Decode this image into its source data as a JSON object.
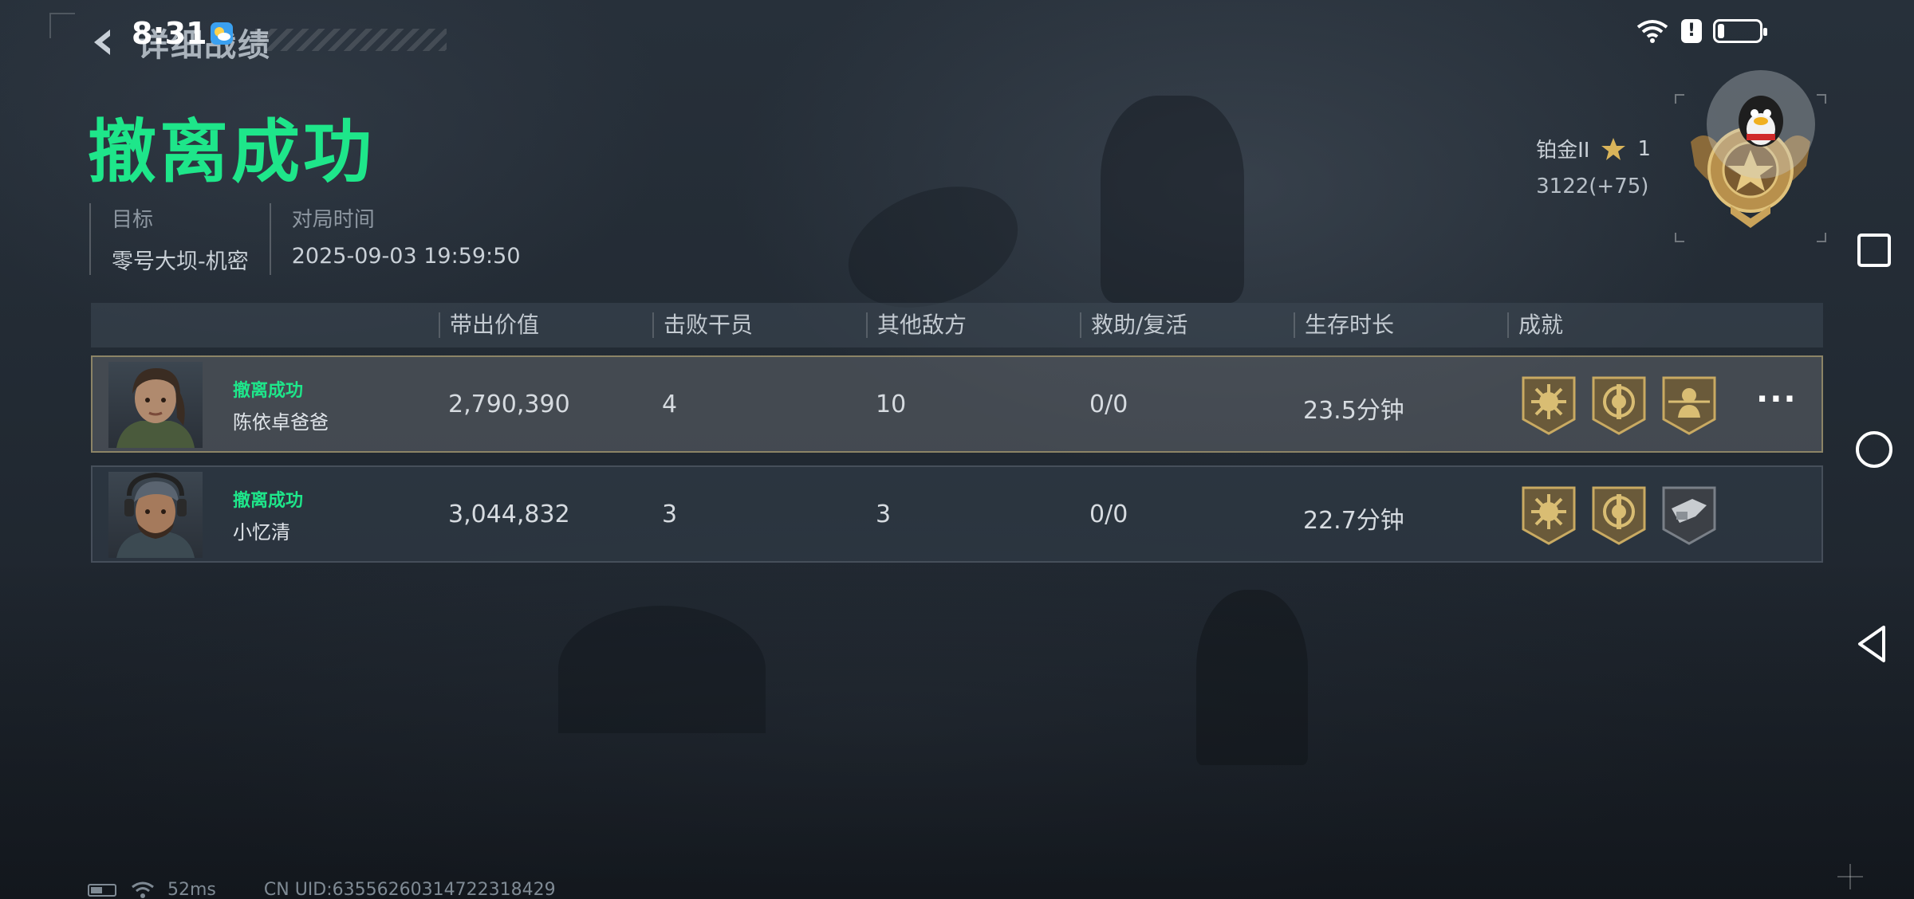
{
  "status_bar": {
    "time": "8:31",
    "battery_level": 0.15
  },
  "header": {
    "back_title": "详细战绩",
    "result": "撤离成功"
  },
  "meta": {
    "target_label": "目标",
    "target_value": "零号大坝-机密",
    "time_label": "对局时间",
    "time_value": "2025-09-03 19:59:50"
  },
  "rank": {
    "tier": "铂金II",
    "stars": "1",
    "score": "3122(+75)"
  },
  "table": {
    "columns": [
      "带出价值",
      "击败干员",
      "其他敌方",
      "救助/复活",
      "生存时长",
      "成就"
    ],
    "rows": [
      {
        "status": "撤离成功",
        "name": "陈依卓爸爸",
        "value": "2,790,390",
        "kills": "4",
        "other": "10",
        "assist": "0/0",
        "survival": "23.5分钟"
      },
      {
        "status": "撤离成功",
        "name": "小忆清",
        "value": "3,044,832",
        "kills": "3",
        "other": "3",
        "assist": "0/0",
        "survival": "22.7分钟"
      }
    ],
    "more_label": "···"
  },
  "footer": {
    "ping": "52ms",
    "uid": "CN UID:6355626031472231​8429"
  },
  "colors": {
    "accent_green": "#1ee68a",
    "medal_gold": "#b89a52",
    "row_border": "#8c8466"
  }
}
